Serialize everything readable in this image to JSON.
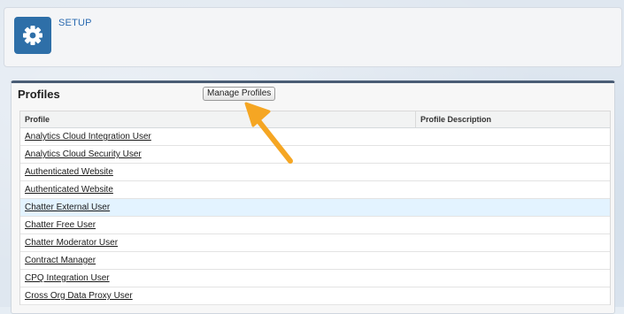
{
  "header": {
    "setup_label": "SETUP",
    "icon": "gear-icon",
    "tile_color": "#2e6fa8"
  },
  "section": {
    "title": "Profiles",
    "manage_button": "Manage Profiles"
  },
  "table": {
    "columns": [
      "Profile",
      "Profile Description"
    ],
    "rows": [
      {
        "profile": "Analytics Cloud Integration User",
        "description": ""
      },
      {
        "profile": "Analytics Cloud Security User",
        "description": ""
      },
      {
        "profile": "Authenticated Website",
        "description": ""
      },
      {
        "profile": "Authenticated Website",
        "description": ""
      },
      {
        "profile": "Chatter External User",
        "description": "",
        "highlighted": true
      },
      {
        "profile": "Chatter Free User",
        "description": ""
      },
      {
        "profile": "Chatter Moderator User",
        "description": ""
      },
      {
        "profile": "Contract Manager",
        "description": ""
      },
      {
        "profile": "CPQ Integration User",
        "description": ""
      },
      {
        "profile": "Cross Org Data Proxy User",
        "description": ""
      }
    ]
  },
  "annotation": {
    "arrow_color": "#f5a623"
  }
}
